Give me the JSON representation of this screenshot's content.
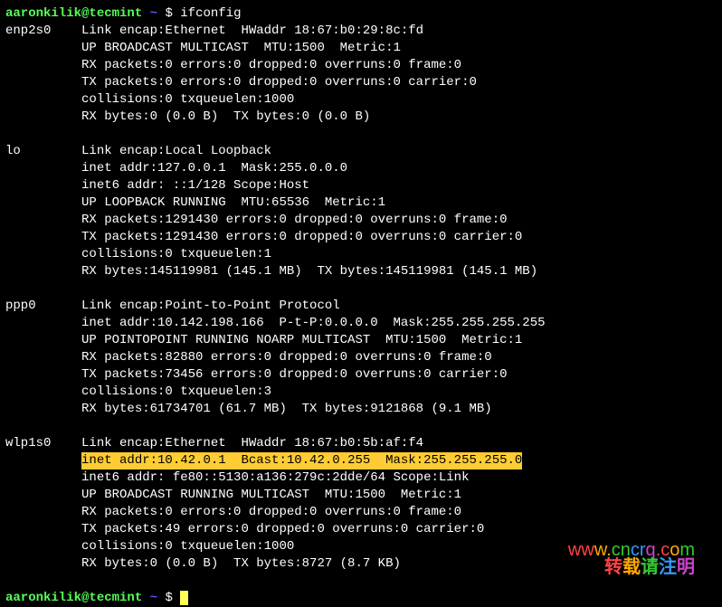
{
  "prompt": {
    "user_host": "aaronkilik@tecmint",
    "tilde": "~",
    "dollar": "$",
    "command": "ifconfig"
  },
  "interfaces": [
    {
      "name": "enp2s0",
      "lines": [
        "Link encap:Ethernet  HWaddr 18:67:b0:29:8c:fd  ",
        "UP BROADCAST MULTICAST  MTU:1500  Metric:1",
        "RX packets:0 errors:0 dropped:0 overruns:0 frame:0",
        "TX packets:0 errors:0 dropped:0 overruns:0 carrier:0",
        "collisions:0 txqueuelen:1000 ",
        "RX bytes:0 (0.0 B)  TX bytes:0 (0.0 B)"
      ]
    },
    {
      "name": "lo",
      "lines": [
        "Link encap:Local Loopback  ",
        "inet addr:127.0.0.1  Mask:255.0.0.0",
        "inet6 addr: ::1/128 Scope:Host",
        "UP LOOPBACK RUNNING  MTU:65536  Metric:1",
        "RX packets:1291430 errors:0 dropped:0 overruns:0 frame:0",
        "TX packets:1291430 errors:0 dropped:0 overruns:0 carrier:0",
        "collisions:0 txqueuelen:1 ",
        "RX bytes:145119981 (145.1 MB)  TX bytes:145119981 (145.1 MB)"
      ]
    },
    {
      "name": "ppp0",
      "lines": [
        "Link encap:Point-to-Point Protocol  ",
        "inet addr:10.142.198.166  P-t-P:0.0.0.0  Mask:255.255.255.255",
        "UP POINTOPOINT RUNNING NOARP MULTICAST  MTU:1500  Metric:1",
        "RX packets:82880 errors:0 dropped:0 overruns:0 frame:0",
        "TX packets:73456 errors:0 dropped:0 overruns:0 carrier:0",
        "collisions:0 txqueuelen:3 ",
        "RX bytes:61734701 (61.7 MB)  TX bytes:9121868 (9.1 MB)"
      ]
    },
    {
      "name": "wlp1s0",
      "lines": [
        "Link encap:Ethernet  HWaddr 18:67:b0:5b:af:f4  ",
        "inet addr:10.42.0.1  Bcast:10.42.0.255  Mask:255.255.255.0",
        "inet6 addr: fe80::5130:a136:279c:2dde/64 Scope:Link",
        "UP BROADCAST RUNNING MULTICAST  MTU:1500  Metric:1",
        "RX packets:0 errors:0 dropped:0 overruns:0 frame:0",
        "TX packets:49 errors:0 dropped:0 overruns:0 carrier:0",
        "collisions:0 txqueuelen:1000 ",
        "RX bytes:0 (0.0 B)  TX bytes:8727 (8.7 KB)"
      ],
      "highlight_index": 1
    }
  ],
  "watermark": {
    "url_chars": [
      "w",
      "w",
      "w",
      ".",
      "c",
      "n",
      "c",
      "r",
      "q",
      ".",
      "c",
      "o",
      "m"
    ],
    "cn": "转载请注明"
  }
}
